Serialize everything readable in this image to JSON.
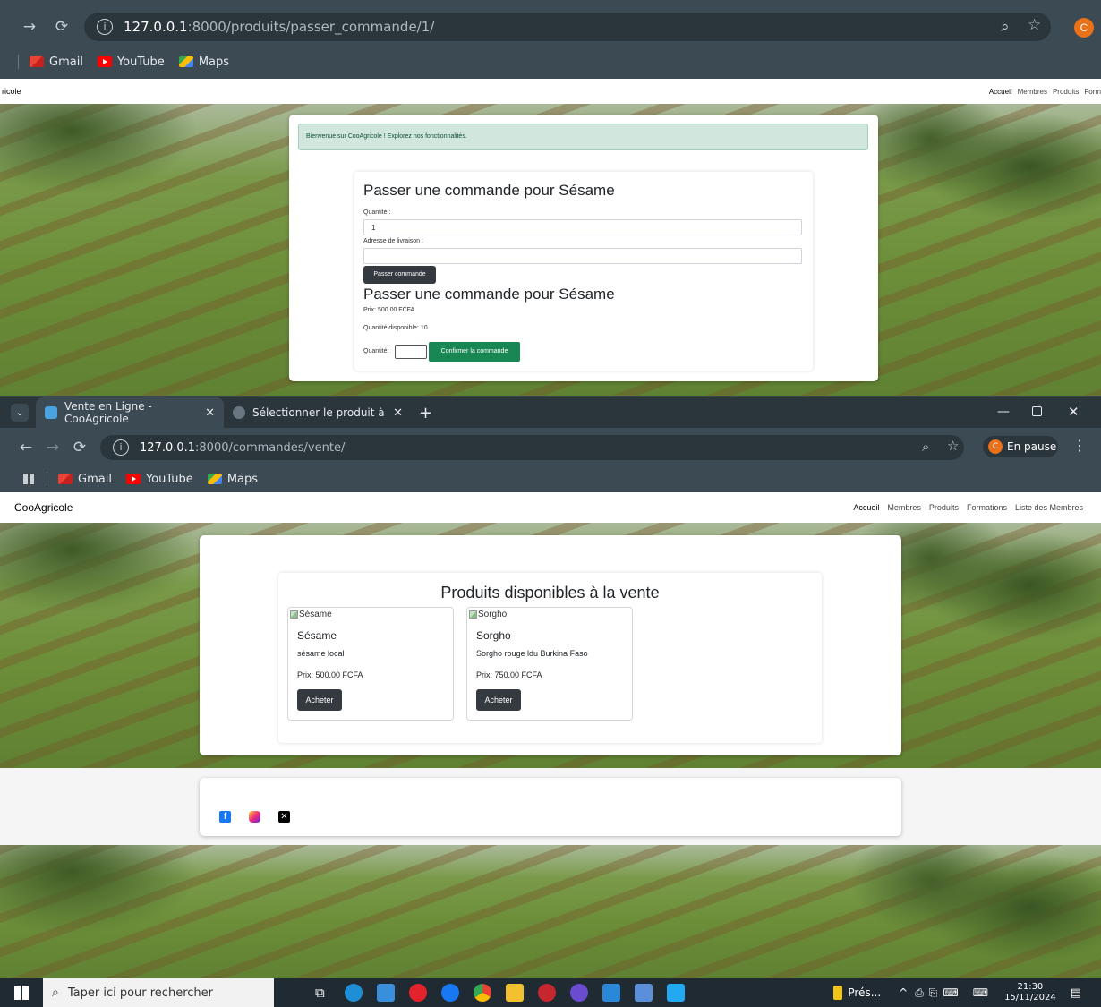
{
  "window1": {
    "url_host": "127.0.0.1",
    "url_rest": ":8000/produits/passer_commande/1/",
    "bookmarks": [
      "Gmail",
      "YouTube",
      "Maps"
    ],
    "site": {
      "brand": "ricole",
      "nav": [
        "Accueil",
        "Membres",
        "Produits",
        "Form"
      ]
    },
    "alert": "Bienvenue sur CooAgricole ! Explorez nos fonctionnalités.",
    "form": {
      "title": "Passer une commande pour Sésame",
      "quantity_label": "Quantité :",
      "quantity_value": "1",
      "address_label": "Adresse de livraison :",
      "address_value": "",
      "submit": "Passer commande"
    },
    "confirm": {
      "title": "Passer une commande pour Sésame",
      "price": "Prix: 500.00 FCFA",
      "stock": "Quantité disponible: 10",
      "quantity_label": "Quantité:",
      "quantity_value": "",
      "submit": "Confirmer la commande"
    }
  },
  "window2": {
    "tabs": [
      {
        "title": "Vente en Ligne - CooAgricole",
        "active": true
      },
      {
        "title": "Sélectionner le produit à modifi",
        "active": false
      }
    ],
    "new_tab": "+",
    "url_host": "127.0.0.1",
    "url_rest": ":8000/commandes/vente/",
    "profile_status": "En pause",
    "bookmarks": [
      "Gmail",
      "YouTube",
      "Maps"
    ],
    "site": {
      "brand": "CooAgricole",
      "nav": [
        "Accueil",
        "Membres",
        "Produits",
        "Formations",
        "Liste des Membres"
      ]
    },
    "section_title": "Produits disponibles à la vente",
    "products": [
      {
        "img_alt": "Sésame",
        "name": "Sésame",
        "description": "sésame local",
        "price": "Prix: 500.00 FCFA",
        "button": "Acheter"
      },
      {
        "img_alt": "Sorgho",
        "name": "Sorgho",
        "description": "Sorgho rouge ldu Burkina Faso",
        "price": "Prix: 750.00 FCFA",
        "button": "Acheter"
      }
    ]
  },
  "taskbar": {
    "search_placeholder": "Taper ici pour rechercher",
    "weather": "Prés...",
    "time": "21:30",
    "date": "15/11/2024"
  },
  "colors": {
    "chrome": "#3c4a54",
    "alert_bg": "#d1e7dd",
    "btn_dark": "#343a40",
    "btn_green": "#198754"
  }
}
